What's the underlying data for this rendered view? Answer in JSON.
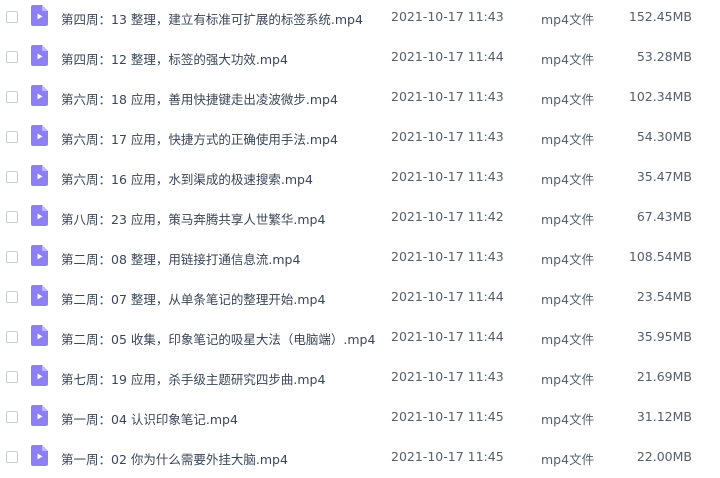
{
  "colors": {
    "icon_fill": "#8f7ff5",
    "icon_fold": "#c2b7fb",
    "icon_play": "#ffffff"
  },
  "files": [
    {
      "name": "第四周：13 整理，建立有标准可扩展的标签系统.mp4",
      "date": "2021-10-17 11:43",
      "type": "mp4文件",
      "size": "152.45MB",
      "icon": "video-file-icon"
    },
    {
      "name": "第四周：12 整理，标签的强大功效.mp4",
      "date": "2021-10-17 11:44",
      "type": "mp4文件",
      "size": "53.28MB",
      "icon": "video-file-icon"
    },
    {
      "name": "第六周：18 应用，善用快捷键走出凌波微步.mp4",
      "date": "2021-10-17 11:43",
      "type": "mp4文件",
      "size": "102.34MB",
      "icon": "video-file-icon"
    },
    {
      "name": "第六周：17 应用，快捷方式的正确使用手法.mp4",
      "date": "2021-10-17 11:43",
      "type": "mp4文件",
      "size": "54.30MB",
      "icon": "video-file-icon"
    },
    {
      "name": "第六周：16 应用，水到渠成的极速搜索.mp4",
      "date": "2021-10-17 11:43",
      "type": "mp4文件",
      "size": "35.47MB",
      "icon": "video-file-icon"
    },
    {
      "name": "第八周：23 应用，策马奔腾共享人世繁华.mp4",
      "date": "2021-10-17 11:42",
      "type": "mp4文件",
      "size": "67.43MB",
      "icon": "video-file-icon"
    },
    {
      "name": "第二周：08 整理，用链接打通信息流.mp4",
      "date": "2021-10-17 11:43",
      "type": "mp4文件",
      "size": "108.54MB",
      "icon": "video-file-icon"
    },
    {
      "name": "第二周：07 整理，从单条笔记的整理开始.mp4",
      "date": "2021-10-17 11:44",
      "type": "mp4文件",
      "size": "23.54MB",
      "icon": "video-file-icon"
    },
    {
      "name": "第二周：05 收集，印象笔记的吸星大法（电脑端）.mp4",
      "date": "2021-10-17 11:44",
      "type": "mp4文件",
      "size": "35.95MB",
      "icon": "video-file-icon"
    },
    {
      "name": "第七周：19 应用，杀手级主题研究四步曲.mp4",
      "date": "2021-10-17 11:43",
      "type": "mp4文件",
      "size": "21.69MB",
      "icon": "video-file-icon"
    },
    {
      "name": "第一周：04 认识印象笔记.mp4",
      "date": "2021-10-17 11:45",
      "type": "mp4文件",
      "size": "31.12MB",
      "icon": "video-file-icon"
    },
    {
      "name": "第一周：02 你为什么需要外挂大脑.mp4",
      "date": "2021-10-17 11:45",
      "type": "mp4文件",
      "size": "22.00MB",
      "icon": "video-file-icon"
    }
  ]
}
